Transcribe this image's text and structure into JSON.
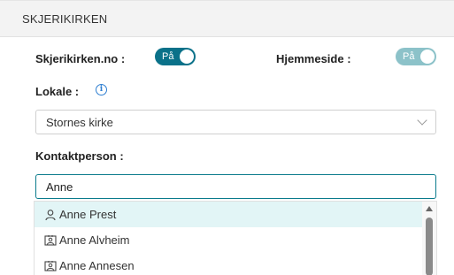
{
  "header": {
    "title": "SKJERIKIRKEN"
  },
  "skjerikirken_no": {
    "label": "Skjerikirken.no :",
    "toggle_text": "På",
    "state": "on"
  },
  "hjemmeside": {
    "label": "Hjemmeside :",
    "toggle_text": "På",
    "state": "on-disabled"
  },
  "lokale": {
    "label": "Lokale :",
    "info_icon": "info-icon",
    "selected": "Stornes kirke"
  },
  "kontaktperson": {
    "label": "Kontaktperson :",
    "value": "Anne",
    "options": [
      {
        "label": "Anne Prest",
        "icon": "person-icon"
      },
      {
        "label": "Anne Alvheim",
        "icon": "contact-card-icon"
      },
      {
        "label": "Anne Annesen",
        "icon": "contact-card-icon"
      }
    ]
  },
  "colors": {
    "accent": "#0a7189",
    "accent_disabled": "#8cc2c9",
    "highlight": "#e2f5f6",
    "info": "#2f7fd1"
  }
}
